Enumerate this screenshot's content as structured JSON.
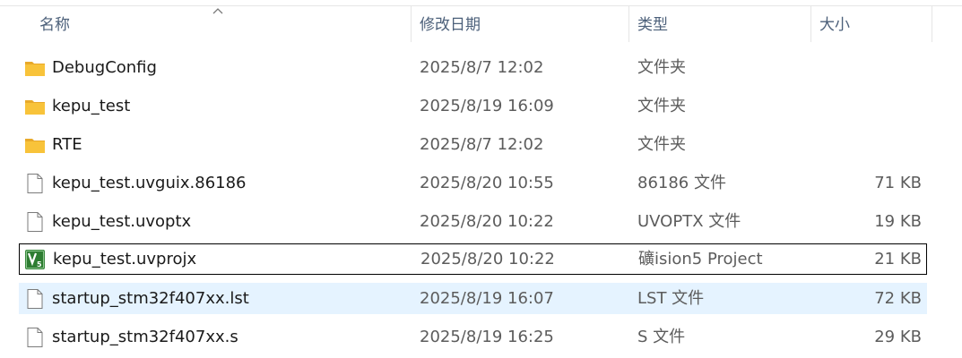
{
  "columns": {
    "name": "名称",
    "date": "修改日期",
    "type": "类型",
    "size": "大小"
  },
  "sort": {
    "column": "name",
    "direction": "ascending",
    "icon": "sort-up-arrow-icon"
  },
  "files": [
    {
      "name": "DebugConfig",
      "date": "2025/8/7 12:02",
      "type": "文件夹",
      "size": "",
      "icon": "folder-icon"
    },
    {
      "name": "kepu_test",
      "date": "2025/8/19 16:09",
      "type": "文件夹",
      "size": "",
      "icon": "folder-icon"
    },
    {
      "name": "RTE",
      "date": "2025/8/7 12:02",
      "type": "文件夹",
      "size": "",
      "icon": "folder-icon"
    },
    {
      "name": "kepu_test.uvguix.86186",
      "date": "2025/8/20 10:55",
      "type": "86186 文件",
      "size": "71 KB",
      "icon": "file-icon"
    },
    {
      "name": "kepu_test.uvoptx",
      "date": "2025/8/20 10:22",
      "type": "UVOPTX 文件",
      "size": "19 KB",
      "icon": "file-icon"
    },
    {
      "name": "kepu_test.uvprojx",
      "date": "2025/8/20 10:22",
      "type": "礦ision5 Project",
      "size": "21 KB",
      "icon": "keil-project-icon",
      "state": "focused"
    },
    {
      "name": "startup_stm32f407xx.lst",
      "date": "2025/8/19 16:07",
      "type": "LST 文件",
      "size": "72 KB",
      "icon": "file-icon",
      "state": "hover"
    },
    {
      "name": "startup_stm32f407xx.s",
      "date": "2025/8/19 16:25",
      "type": "S 文件",
      "size": "29 KB",
      "icon": "file-icon"
    }
  ],
  "colors": {
    "header_text": "#4c607a",
    "hover_bg": "#e5f3ff",
    "folder": "#f8c33a",
    "keil_green": "#2e7d32"
  }
}
